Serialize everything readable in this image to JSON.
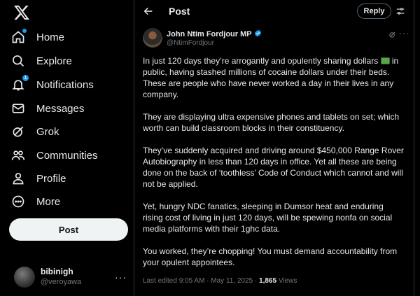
{
  "sidebar": {
    "logo": "X",
    "items": [
      {
        "label": "Home",
        "icon": "home-icon"
      },
      {
        "label": "Explore",
        "icon": "search-icon"
      },
      {
        "label": "Notifications",
        "icon": "bell-icon",
        "badge": "1"
      },
      {
        "label": "Messages",
        "icon": "mail-icon"
      },
      {
        "label": "Grok",
        "icon": "grok-icon"
      },
      {
        "label": "Communities",
        "icon": "people-icon"
      },
      {
        "label": "Profile",
        "icon": "person-icon"
      },
      {
        "label": "More",
        "icon": "more-circle-icon"
      }
    ],
    "post_button": "Post",
    "account": {
      "name": "bibinigh",
      "handle": "@veroyawa",
      "more": "···"
    }
  },
  "header": {
    "title": "Post",
    "reply_button": "Reply"
  },
  "tweet": {
    "author_name": "John Ntim Fordjour MP",
    "author_handle": "@NtimFordjour",
    "paragraphs": [
      [
        "In just 120 days they’re arrogantly and opulently sharing dollars ",
        " in public, having stashed millions of cocaine dollars under their beds. These are people who have never worked a day in their lives in any company."
      ],
      "They are displaying ultra expensive phones and tablets on set; which worth can build classroom blocks in their constituency.",
      "They’ve suddenly acquired and driving around $450,000 Range Rover Autobiography in less than 120 days in office. Yet all these are being done on the back of ‘toothless’ Code of Conduct which cannot and will not be applied.",
      "Yet, hungry NDC fanatics, sleeping in Dumsor heat and enduring rising cost of living in just 120 days, will be spewing nonfa on social media platforms with their 1ghc data.",
      "You worked, they’re chopping! You must demand accountability from your opulent appointees."
    ],
    "meta": {
      "edited": "Last edited 9:05 AM · May 11, 2025 · ",
      "views_count": "1,865",
      "views_label": " Views"
    }
  },
  "colors": {
    "accent": "#1d9bf0",
    "background": "#000000",
    "text": "#e7e9ea",
    "muted": "#71767b",
    "border": "#2f3336"
  }
}
